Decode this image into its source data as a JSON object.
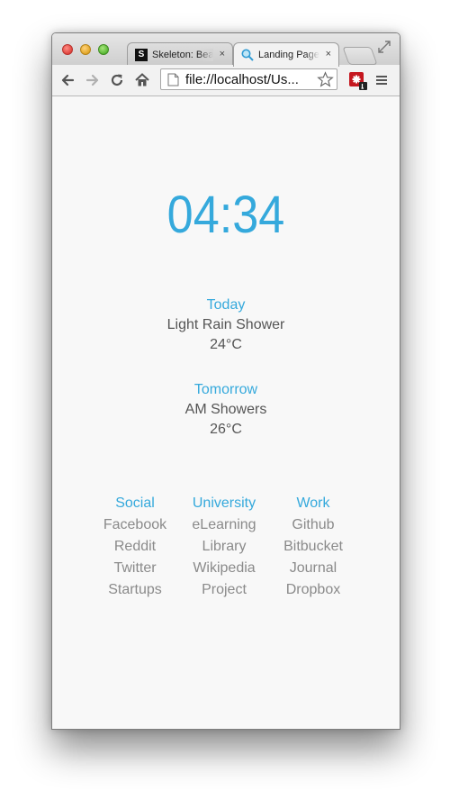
{
  "browser": {
    "tabs": [
      {
        "favicon": "S",
        "title": "Skeleton: Beautiful Boilerplate",
        "close": "×"
      },
      {
        "title": "Landing Page",
        "close": "×"
      }
    ],
    "url": "file://localhost/Us..."
  },
  "page": {
    "clock": "04:34",
    "weather": [
      {
        "heading": "Today",
        "condition": "Light Rain Shower",
        "temp": "24°C"
      },
      {
        "heading": "Tomorrow",
        "condition": "AM Showers",
        "temp": "26°C"
      }
    ],
    "link_groups": [
      {
        "heading": "Social",
        "links": [
          "Facebook",
          "Reddit",
          "Twitter",
          "Startups"
        ]
      },
      {
        "heading": "University",
        "links": [
          "eLearning",
          "Library",
          "Wikipedia",
          "Project"
        ]
      },
      {
        "heading": "Work",
        "links": [
          "Github",
          "Bitbucket",
          "Journal",
          "Dropbox"
        ]
      }
    ]
  },
  "colors": {
    "accent": "#35a9dc",
    "text": "#555555",
    "link": "#8a8a8a",
    "background": "#f8f8f8"
  }
}
